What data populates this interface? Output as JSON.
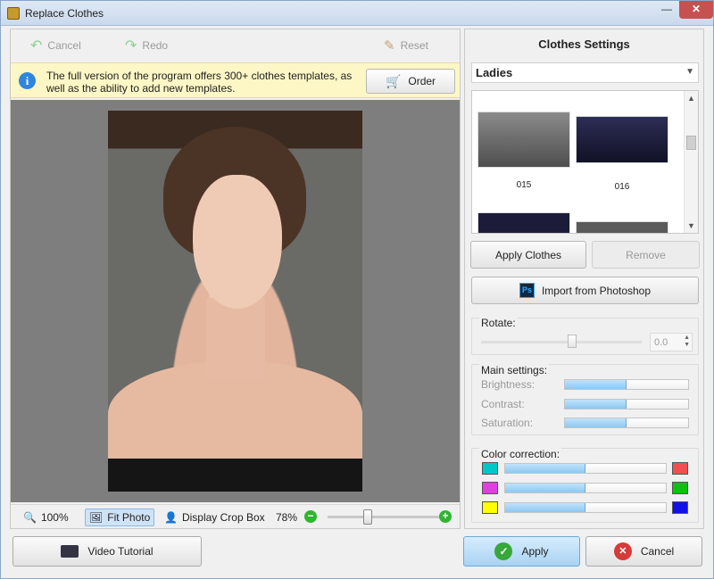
{
  "window": {
    "title": "Replace Clothes",
    "minimize_glyph": "—",
    "close_glyph": "✕"
  },
  "toolbar": {
    "cancel_label": "Cancel",
    "redo_label": "Redo",
    "reset_label": "Reset"
  },
  "info": {
    "icon_glyph": "i",
    "text": "The full version of the program offers 300+ clothes templates, as well as the ability to add new templates.",
    "order_label": "Order"
  },
  "zoom": {
    "actual_label": "100%",
    "fit_label": "Fit Photo",
    "crop_label": "Display Crop Box",
    "level_label": "78%",
    "minus_glyph": "−",
    "plus_glyph": "+",
    "level_fraction": 0.35
  },
  "settings": {
    "title": "Clothes Settings",
    "category": "Ladies",
    "templates": [
      {
        "label": "015"
      },
      {
        "label": "016"
      }
    ],
    "apply_clothes_label": "Apply Clothes",
    "remove_label": "Remove",
    "import_label": "Import from Photoshop",
    "ps_glyph": "Ps",
    "rotate": {
      "label": "Rotate:",
      "value": "0.0"
    },
    "main": {
      "label": "Main settings:",
      "brightness_label": "Brightness:",
      "contrast_label": "Contrast:",
      "saturation_label": "Saturation:",
      "brightness": 0.5,
      "contrast": 0.5,
      "saturation": 0.5
    },
    "color": {
      "label": "Color correction:",
      "rows": [
        {
          "left": "#00c8c8",
          "right": "#f25050",
          "value": 0.5
        },
        {
          "left": "#e040e0",
          "right": "#10c010",
          "value": 0.5
        },
        {
          "left": "#ffff00",
          "right": "#1010e8",
          "value": 0.5
        }
      ]
    }
  },
  "footer": {
    "video_label": "Video Tutorial",
    "apply_label": "Apply",
    "cancel_label": "Cancel",
    "ok_glyph": "✓",
    "x_glyph": "✕"
  }
}
